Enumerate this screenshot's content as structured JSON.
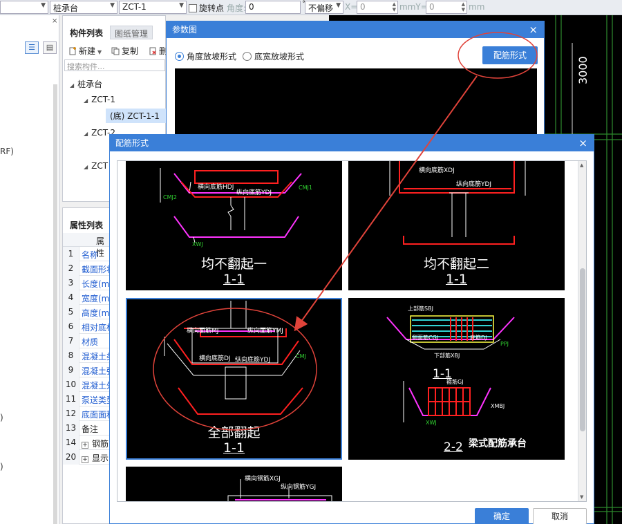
{
  "toolbar": {
    "type_value": "桩承台",
    "name_value": "ZCT-1",
    "rotate_label": "旋转点",
    "angle_label": "角度:",
    "angle_value": "0",
    "degree_mark": "°",
    "offset_value": "不偏移",
    "x_label": "X=",
    "x_value": "0",
    "mm_y_label": "mmY=",
    "y_value": "0",
    "mm_label": "mm"
  },
  "left_panel": {
    "close": "×",
    "frag_rf": "RF)",
    "frag_paren": ")"
  },
  "component_panel": {
    "tabs": [
      "构件列表",
      "图纸管理"
    ],
    "tools": {
      "new": "新建",
      "copy": "复制",
      "delete": "删"
    },
    "search_placeholder": "搜索构件...",
    "tree": {
      "root": "桩承台",
      "items": [
        "ZCT-1",
        "(底) ZCT-1-1",
        "ZCT-2",
        "ZCT"
      ]
    }
  },
  "property_panel": {
    "tab": "属性列表",
    "column_header": "属性",
    "rows": [
      {
        "num": "1",
        "name": "名称",
        "blue": true
      },
      {
        "num": "2",
        "name": "截面形状",
        "blue": true
      },
      {
        "num": "3",
        "name": "长度(m",
        "blue": true
      },
      {
        "num": "4",
        "name": "宽度(m",
        "blue": true
      },
      {
        "num": "5",
        "name": "高度(m",
        "blue": true
      },
      {
        "num": "6",
        "name": "相对底标",
        "blue": true
      },
      {
        "num": "7",
        "name": "材质",
        "blue": true
      },
      {
        "num": "8",
        "name": "混凝土类",
        "blue": true
      },
      {
        "num": "9",
        "name": "混凝土强",
        "blue": true
      },
      {
        "num": "10",
        "name": "混凝土外",
        "blue": true
      },
      {
        "num": "11",
        "name": "泵送类型",
        "blue": true
      },
      {
        "num": "12",
        "name": "底面面积",
        "blue": true
      },
      {
        "num": "13",
        "name": "备注",
        "blue": false
      },
      {
        "num": "14",
        "name": "钢筋",
        "blue": false,
        "expand": true
      },
      {
        "num": "20",
        "name": "显示",
        "blue": false,
        "expand": true
      }
    ]
  },
  "param_dialog": {
    "title": "参数图",
    "close": "×",
    "radio_angle": "角度放坡形式",
    "radio_width": "底宽放坡形式",
    "rebar_button": "配筋形式"
  },
  "rebar_dialog": {
    "title": "配筋形式",
    "close": "×",
    "ok": "确定",
    "cancel": "取消",
    "options": [
      {
        "caption": "均不翻起一",
        "section": "1-1",
        "labels": [
          "横向底筋HDJ",
          "纵向底筋YDJ",
          "CMJ1",
          "CMJ2",
          "XWJ"
        ]
      },
      {
        "caption": "均不翻起二",
        "section": "1-1",
        "labels": [
          "横向底筋XDJ",
          "纵向底筋YDJ"
        ]
      },
      {
        "caption": "全部翻起",
        "section": "1-1",
        "labels": [
          "横向面筋MJ",
          "纵向面筋YMJ",
          "横向底筋DJ",
          "纵向底筋YDJ",
          "CMJ"
        ]
      },
      {
        "caption": "梁式配筋承台",
        "section": "1-1",
        "section2": "2-2",
        "labels": [
          "上部筋SBJ",
          "侧面筋CGJ",
          "底筋DJ",
          "下部筋XBJ",
          "PPJ",
          "箍筋GJ",
          "XMBJ",
          "XWJ"
        ]
      },
      {
        "caption": "",
        "section": "",
        "labels": [
          "横向钢筋XGJ",
          "纵向钢筋YGJ"
        ]
      }
    ]
  },
  "canvas": {
    "dimension": "3000"
  },
  "colors": {
    "accent": "#3a7fd8",
    "annotation": "#e0433a",
    "rebar_red": "#ff2020",
    "rebar_magenta": "#ff33ff",
    "label_green": "#31d431",
    "grid_green": "#2e8b2e"
  }
}
